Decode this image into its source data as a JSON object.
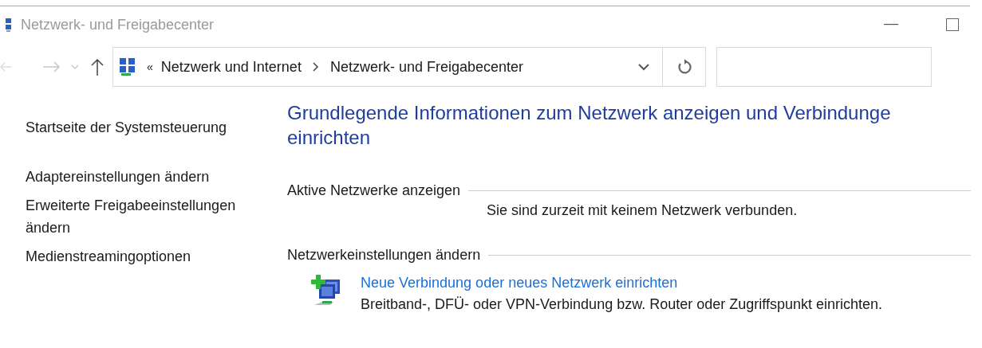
{
  "window": {
    "title": "Netzwerk- und Freigabecenter"
  },
  "address_bar": {
    "overflow": "«",
    "crumbs": [
      "Netzwerk und Internet",
      "Netzwerk- und Freigabecenter"
    ]
  },
  "sidebar": {
    "items": [
      "Startseite der Systemsteuerung",
      "Adaptereinstellungen ändern",
      "Erweiterte Freigabeeinstellungen ändern",
      "Medienstreamingoptionen"
    ]
  },
  "heading_lines": [
    "Grundlegende Informationen zum Netzwerk anzeigen und Verbindunge",
    "einrichten"
  ],
  "sections": [
    {
      "title": "Aktive Netzwerke anzeigen",
      "message": "Sie sind zurzeit mit keinem Netzwerk verbunden."
    },
    {
      "title": "Netzwerkeinstellungen ändern",
      "tasks": [
        {
          "link": "Neue Verbindung oder neues Netzwerk einrichten",
          "description": "Breitband-, DFÜ- oder VPN-Verbindung bzw. Router oder Zugriffspunkt einrichten."
        }
      ]
    }
  ]
}
